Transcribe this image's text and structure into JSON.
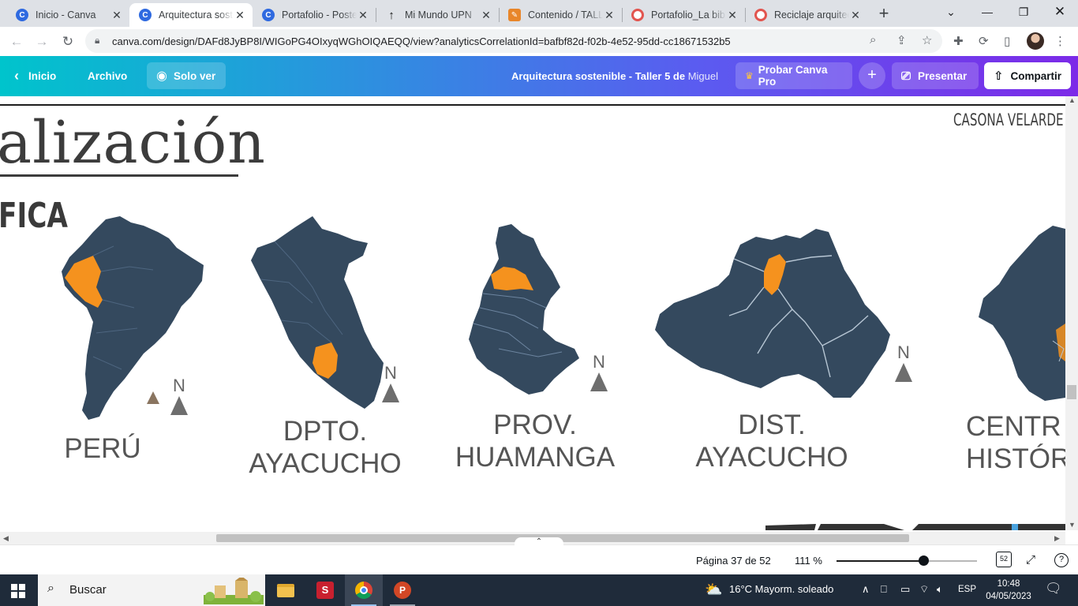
{
  "browser": {
    "tabs": [
      {
        "title": "Inicio - Canva",
        "favicon": "canva-icon",
        "color": "#2f6ae0",
        "active": false
      },
      {
        "title": "Arquitectura sostenible",
        "favicon": "canva-icon",
        "color": "#2f6ae0",
        "active": true
      },
      {
        "title": "Portafolio - Poster",
        "favicon": "canva-icon",
        "color": "#2f6ae0",
        "active": false
      },
      {
        "title": "Mi Mundo UPN",
        "favicon": "upn-icon",
        "color": "#111111",
        "active": false
      },
      {
        "title": "Contenido / TALLER",
        "favicon": "pencil-icon",
        "color": "#e8862a",
        "active": false
      },
      {
        "title": "Portafolio_La biblioteca",
        "favicon": "target-icon",
        "color": "#e2554f",
        "active": false
      },
      {
        "title": "Reciclaje arquitectónico",
        "favicon": "target-icon",
        "color": "#e2554f",
        "active": false
      }
    ],
    "url": "canva.com/design/DAFd8JyBP8I/WIGoPG4OIxyqWGhOIQAEQQ/view?analyticsCorrelationId=bafbf82d-f02b-4e52-95dd-cc18671532b5"
  },
  "canva": {
    "home_label": "Inicio",
    "file_label": "Archivo",
    "view_only_label": "Solo ver",
    "doc_title": "Arquitectura sostenible - Taller 5 de",
    "doc_owner": "Miguel",
    "pro_label": "Probar Canva Pro",
    "present_label": "Presentar",
    "share_label": "Compartir"
  },
  "slide": {
    "title": "alización",
    "subtitle": "FICA",
    "corner_text": "CASONA VELARDE ÁL",
    "north_letter": "N",
    "maps": [
      {
        "label_lines": [
          "PERÚ"
        ]
      },
      {
        "label_lines": [
          "DPTO.",
          "AYACUCHO"
        ]
      },
      {
        "label_lines": [
          "PROV.",
          "HUAMANGA"
        ]
      },
      {
        "label_lines": [
          "DIST.",
          "AYACUCHO"
        ]
      },
      {
        "label_lines": [
          "CENTR",
          "HISTÓRI"
        ]
      }
    ],
    "colors": {
      "map_fill": "#34495e",
      "highlight": "#f5921e",
      "text": "#555555"
    }
  },
  "footer": {
    "page_text": "Página 37 de 52",
    "zoom_text": "111 %",
    "zoom_fraction": 0.62,
    "pages_badge": "52"
  },
  "taskbar": {
    "search_placeholder": "Buscar",
    "weather": "16°C  Mayorm. soleado",
    "language": "ESP",
    "time": "10:48",
    "date": "04/05/2023"
  }
}
